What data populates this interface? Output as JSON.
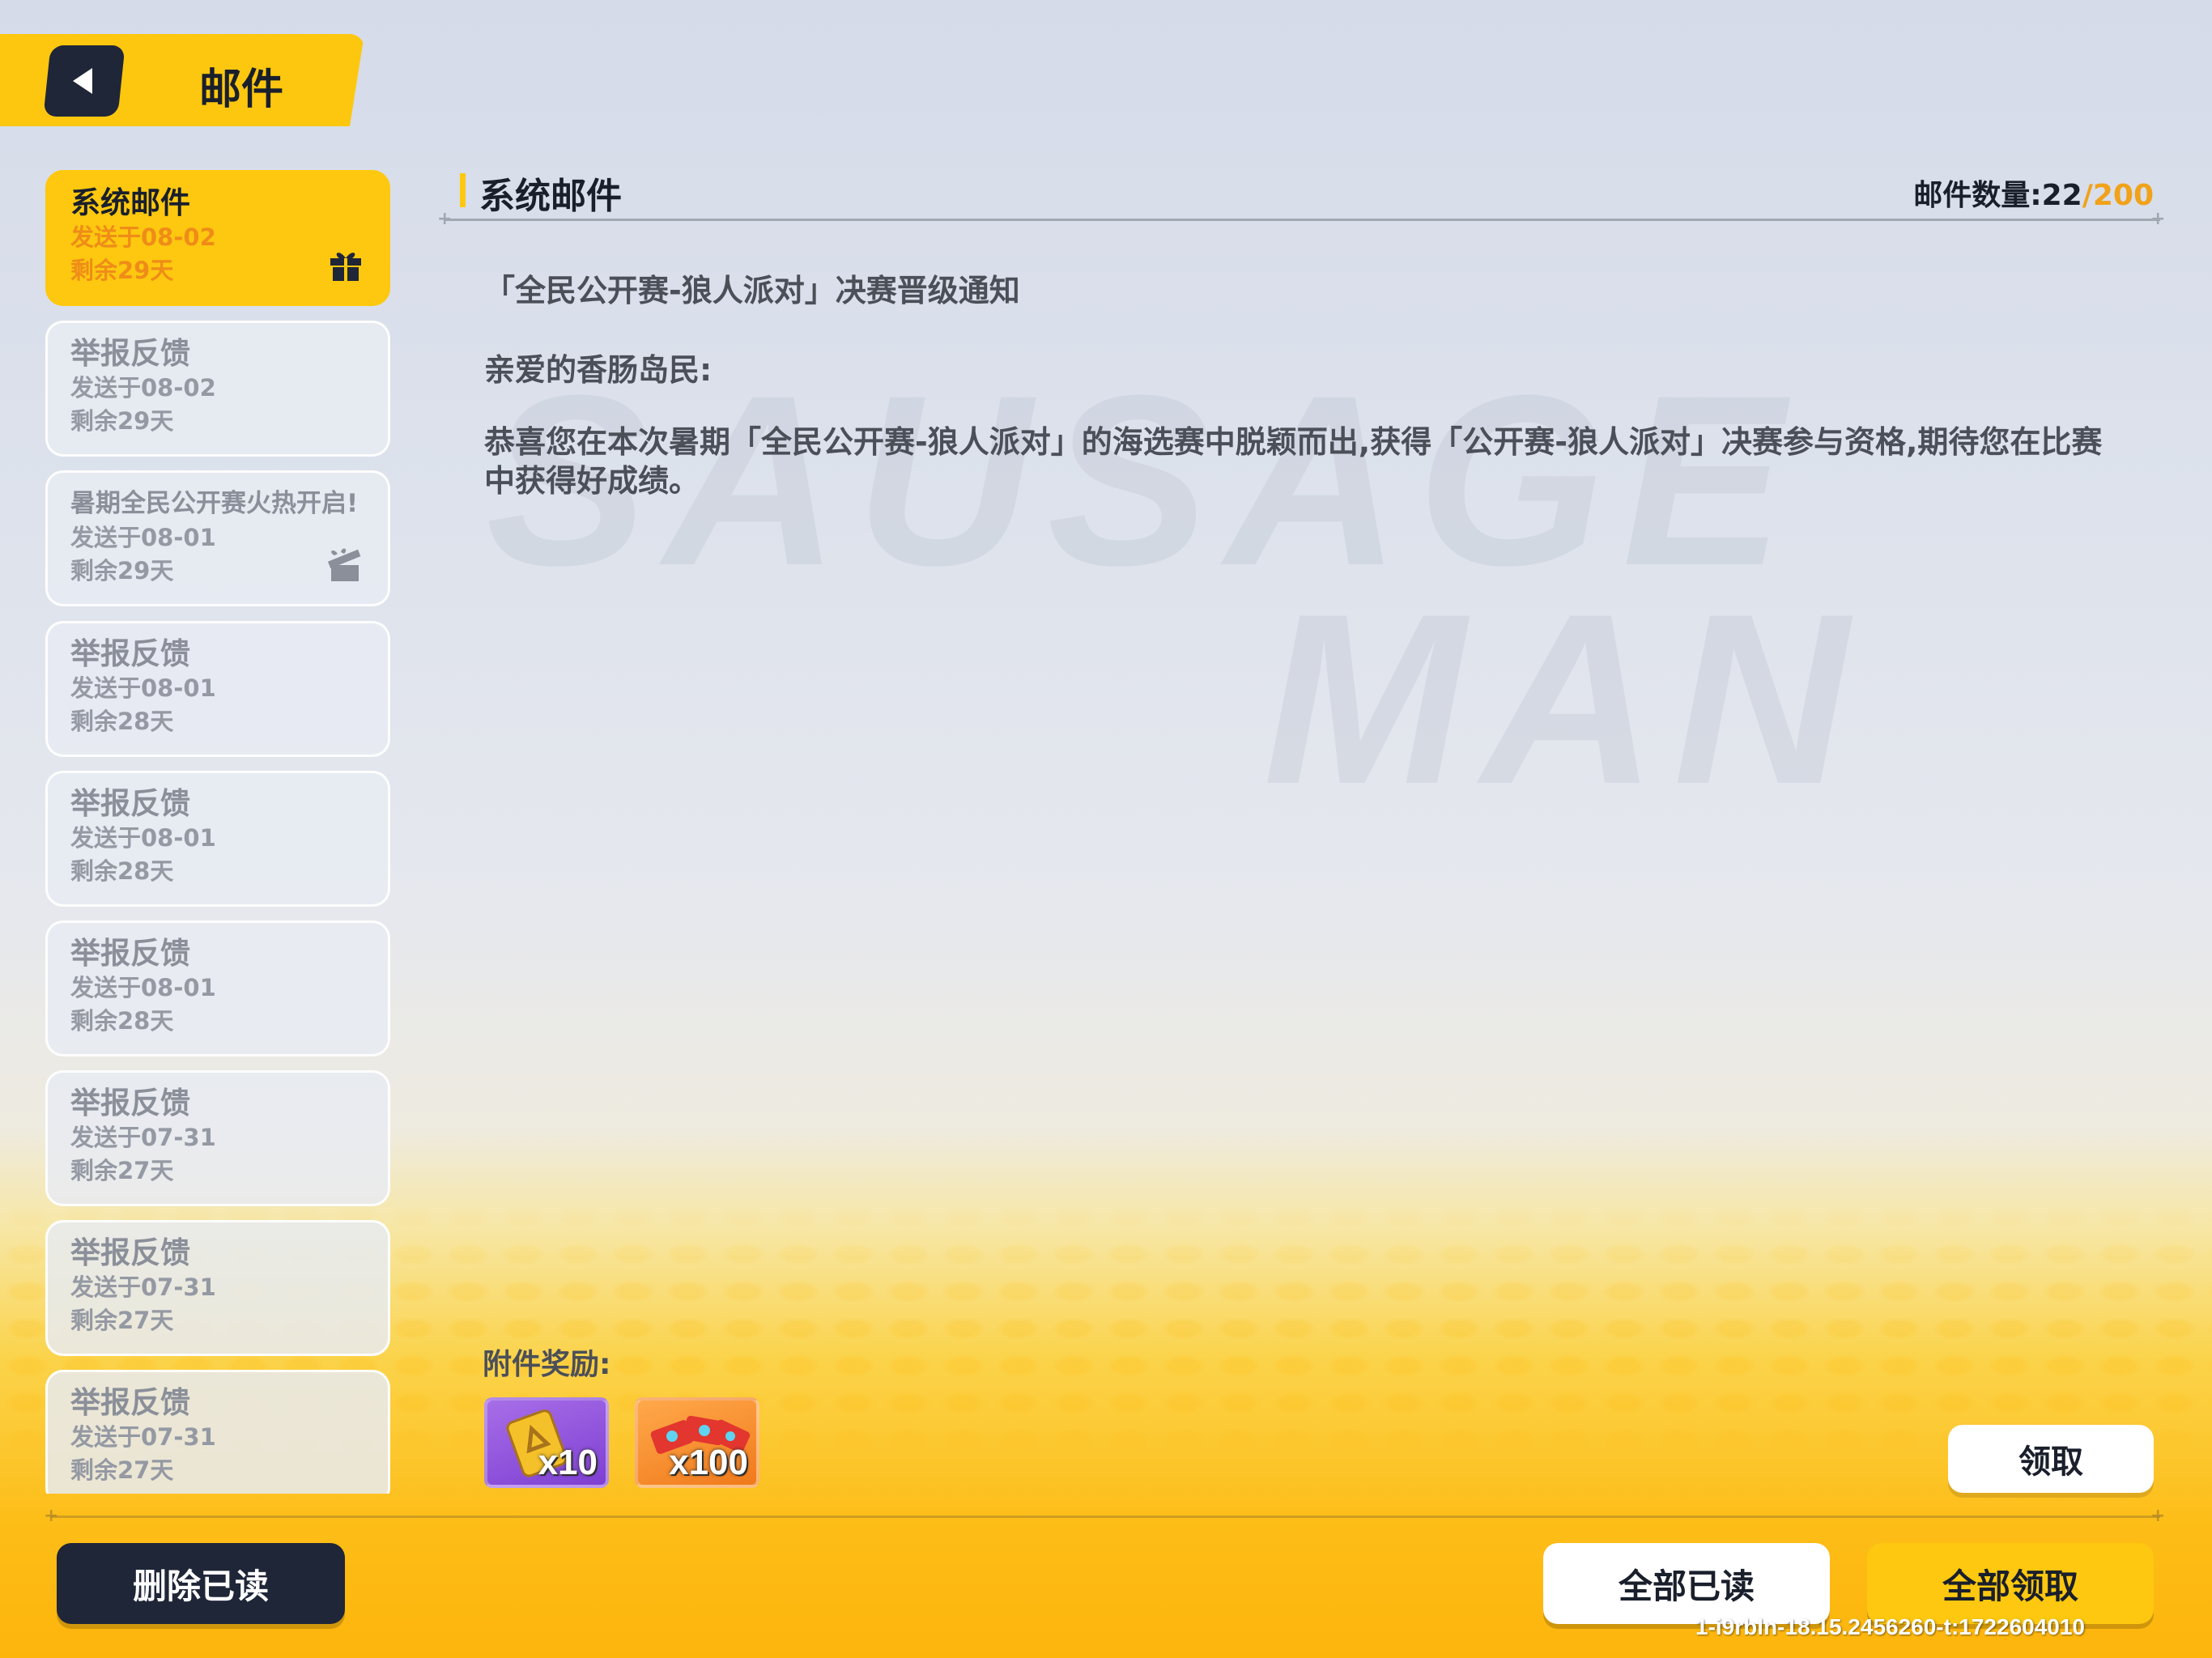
{
  "header": {
    "title": "邮件"
  },
  "mails": [
    {
      "title": "系统邮件",
      "sent": "发送于08-02",
      "remaining": "剩余29天",
      "active": true,
      "attachment": "closed"
    },
    {
      "title": "举报反馈",
      "sent": "发送于08-02",
      "remaining": "剩余29天"
    },
    {
      "title": "暑期全民公开赛火热开启!",
      "sent": "发送于08-01",
      "remaining": "剩余29天",
      "attachment": "opened"
    },
    {
      "title": "举报反馈",
      "sent": "发送于08-01",
      "remaining": "剩余28天"
    },
    {
      "title": "举报反馈",
      "sent": "发送于08-01",
      "remaining": "剩余28天"
    },
    {
      "title": "举报反馈",
      "sent": "发送于08-01",
      "remaining": "剩余28天"
    },
    {
      "title": "举报反馈",
      "sent": "发送于07-31",
      "remaining": "剩余27天"
    },
    {
      "title": "举报反馈",
      "sent": "发送于07-31",
      "remaining": "剩余27天"
    },
    {
      "title": "举报反馈",
      "sent": "发送于07-31",
      "remaining": "剩余27天"
    }
  ],
  "content": {
    "title": "系统邮件",
    "count_label": "邮件数量:",
    "count_current": "22",
    "count_max": "/200",
    "heading": "「全民公开赛-狼人派对」决赛晋级通知",
    "greeting": "亲爱的香肠岛民:",
    "body": "恭喜您在本次暑期「全民公开赛-狼人派对」的海选赛中脱颖而出,获得「公开赛-狼人派对」决赛参与资格,期待您在比赛中获得好成绩。",
    "attachments_label": "附件奖励:",
    "rewards": [
      {
        "icon": "gold-ticket-icon",
        "qty": "x10",
        "color": "#8f52dd"
      },
      {
        "icon": "red-cards-icon",
        "qty": "x100",
        "color": "#f58a2a"
      }
    ],
    "claim_label": "领取"
  },
  "footer": {
    "delete_read_label": "删除已读",
    "read_all_label": "全部已读",
    "claim_all_label": "全部领取",
    "version": "1-i9rbln-18.15.2456260-t:1722604010"
  },
  "colors": {
    "accent": "#fdc80f",
    "dark": "#1f2638",
    "highlight": "#ef8c18"
  }
}
